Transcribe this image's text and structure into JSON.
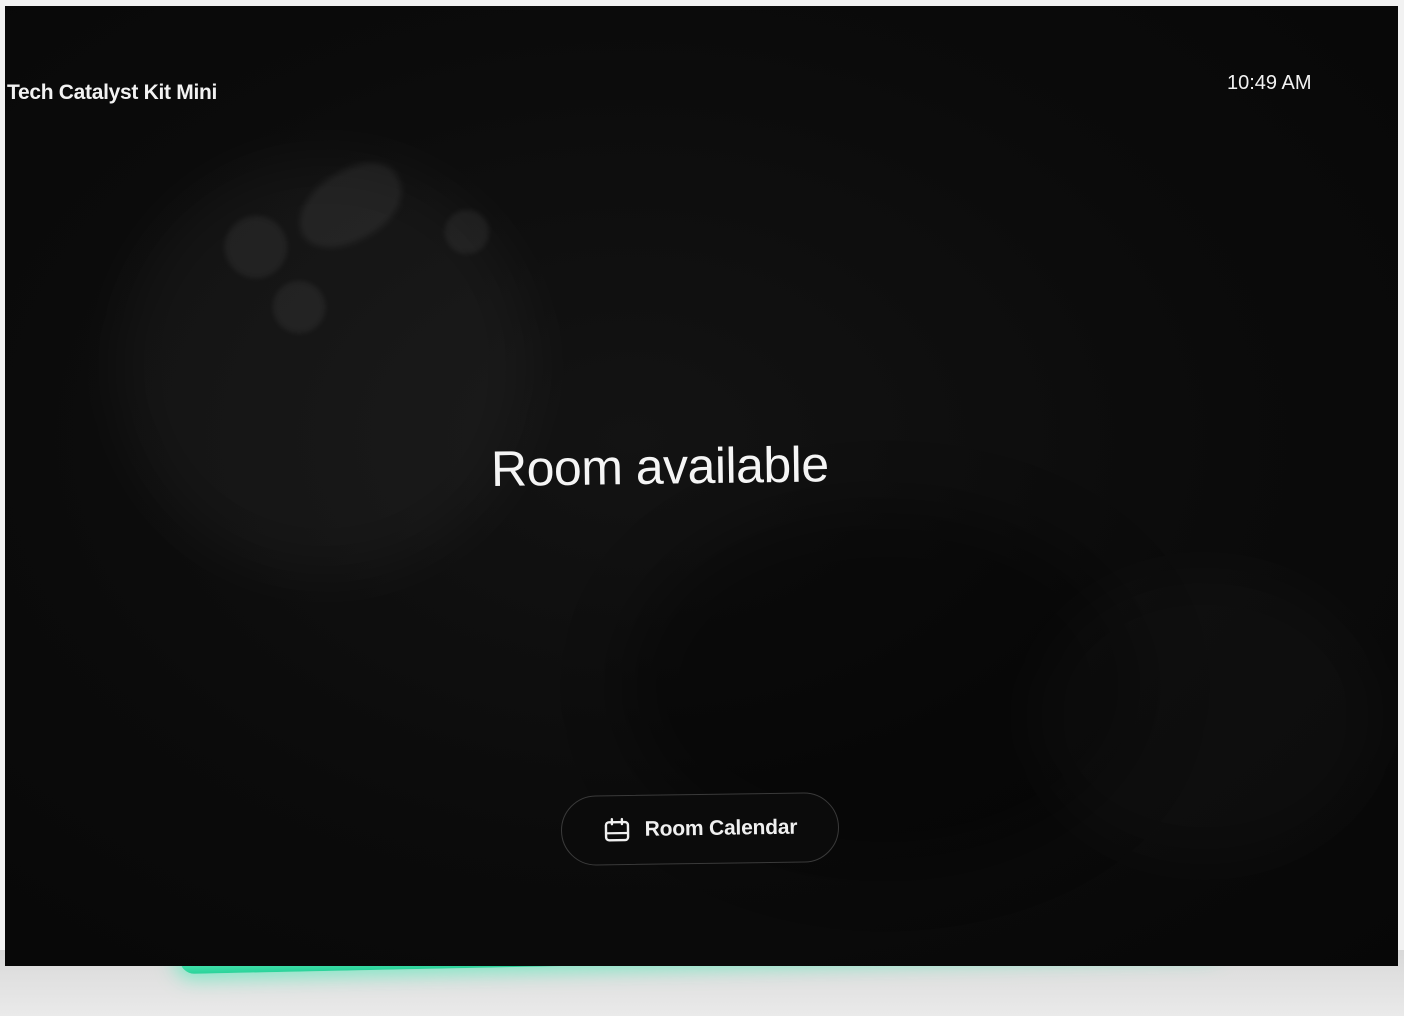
{
  "device": {
    "room_name": "Tech Catalyst Kit Mini",
    "time": "10:49 AM"
  },
  "main": {
    "status_text": "Room available"
  },
  "actions": {
    "room_calendar_label": "Room Calendar",
    "room_calendar_icon": "calendar-icon"
  },
  "colors": {
    "screen_background": "#0b0b0b",
    "text": "#f2f2f2",
    "button_border": "#3a3a3a",
    "led_strip": "#5ef2c0"
  }
}
